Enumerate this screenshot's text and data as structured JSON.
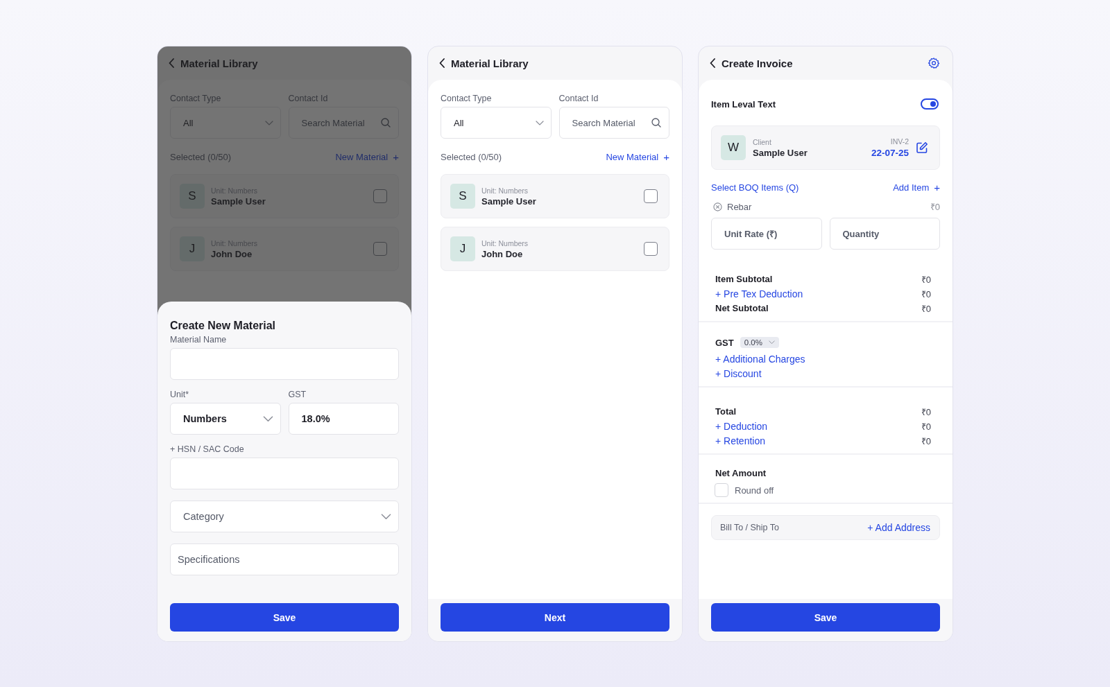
{
  "screens": [
    {
      "kind": "library",
      "title": "Material Library",
      "dimmed": true,
      "filters": [
        {
          "kind": "select",
          "label": "Contact Type",
          "value": "All"
        },
        {
          "kind": "search",
          "label": "Contact Id",
          "placeholder": "Search Material"
        }
      ],
      "selected_text": "Selected (0/50)",
      "new_link": {
        "label": "New Material",
        "icon": "+"
      },
      "items": [
        {
          "initial": "S",
          "unit": "Unit: Numbers",
          "name": "Sample User",
          "checked": false
        },
        {
          "initial": "J",
          "unit": "Unit: Numbers",
          "name": "John Doe",
          "checked": false
        }
      ],
      "sheet": {
        "title": "Create New Material",
        "field_rows": [
          [
            {
              "kind": "text",
              "label": "Material Name"
            }
          ],
          [
            {
              "kind": "select",
              "label": "Unit*",
              "value": "Numbers"
            },
            {
              "kind": "text",
              "label": "GST",
              "value": "18.0%"
            }
          ],
          [
            {
              "kind": "text",
              "label": "+ HSN / SAC Code"
            }
          ],
          [
            {
              "kind": "select",
              "placeholder": "Category"
            }
          ],
          [
            {
              "kind": "text",
              "placeholder": "Specifications"
            }
          ]
        ],
        "button": "Save"
      }
    },
    {
      "kind": "library",
      "title": "Material Library",
      "dimmed": false,
      "filters": [
        {
          "kind": "select",
          "label": "Contact Type",
          "value": "All"
        },
        {
          "kind": "search",
          "label": "Contact Id",
          "placeholder": "Search Material"
        }
      ],
      "selected_text": "Selected (0/50)",
      "new_link": {
        "label": "New Material",
        "icon": "+"
      },
      "items": [
        {
          "initial": "S",
          "unit": "Unit: Numbers",
          "name": "Sample User",
          "checked": false
        },
        {
          "initial": "J",
          "unit": "Unit: Numbers",
          "name": "John Doe",
          "checked": false
        }
      ],
      "button": "Next"
    },
    {
      "kind": "invoice",
      "title": "Create Invoice",
      "toggle": {
        "label": "Item Leval Text",
        "on": true
      },
      "client": {
        "initial": "W",
        "caption": "Client",
        "name": "Sample User",
        "number": "INV-2",
        "date": "22-07-25"
      },
      "boq_link": "Select BOQ Items (Q)",
      "add_item": {
        "label": "Add Item",
        "icon": "+"
      },
      "line_item": {
        "name": "Rebar",
        "amount": "₹0",
        "fields": [
          {
            "placeholder": "Unit Rate (₹)"
          },
          {
            "placeholder": "Quantity"
          }
        ]
      },
      "sections": [
        {
          "rows": [
            {
              "kind": "text",
              "label": "Item Subtotal",
              "amount": "₹0"
            },
            {
              "kind": "link",
              "label": "+ Pre Tex Deduction",
              "amount": "₹0"
            },
            {
              "kind": "text",
              "label": "Net Subtotal",
              "amount": "₹0"
            }
          ]
        },
        {
          "rows": [
            {
              "kind": "select",
              "label": "GST",
              "value": "0.0%"
            },
            {
              "kind": "link",
              "label": "+ Additional Charges"
            },
            {
              "kind": "link",
              "label": "+ Discount"
            }
          ]
        },
        {
          "rows": [
            {
              "kind": "text",
              "label": "Total",
              "amount": "₹0"
            },
            {
              "kind": "link",
              "label": "+ Deduction",
              "amount": "₹0"
            },
            {
              "kind": "link",
              "label": "+ Retention",
              "amount": "₹0"
            }
          ]
        },
        {
          "rows": [
            {
              "kind": "text",
              "label": "Net Amount"
            },
            {
              "kind": "checkbox",
              "label": "Round off",
              "checked": false
            }
          ]
        },
        {
          "rows": [
            {
              "kind": "address",
              "label": "Bill To / Ship To",
              "link": "+ Add Address"
            }
          ]
        }
      ],
      "button": "Save"
    }
  ]
}
